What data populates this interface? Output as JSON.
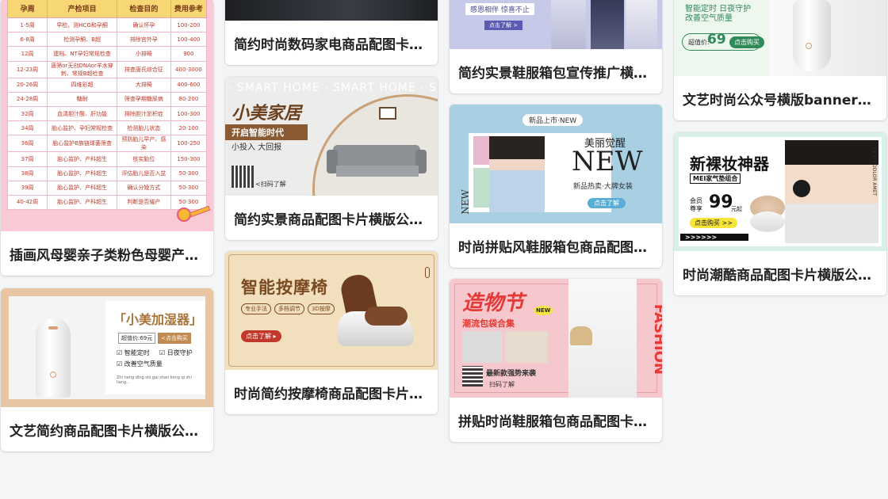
{
  "cards": [
    {
      "title": "插画风母婴亲子类粉色母婴产检时间表"
    },
    {
      "title": "文艺简约商品配图卡片横版公众号首图"
    },
    {
      "title": "简约时尚数码家电商品配图卡片横版"
    },
    {
      "title": "简约实景商品配图卡片横版公众号首图"
    },
    {
      "title": "时尚简约按摩椅商品配图卡片横版公众号"
    },
    {
      "title": "简约实景鞋服箱包宣传推广横版配图"
    },
    {
      "title": "时尚拼贴风鞋服箱包商品配图卡片横版"
    },
    {
      "title": "拼贴时尚鞋服箱包商品配图卡片横版"
    },
    {
      "title": "文艺时尚公众号横版banner配图"
    },
    {
      "title": "时尚潮酷商品配图卡片横版公众号首图"
    }
  ],
  "schedule": {
    "headers": [
      "孕周",
      "产检项目",
      "检查目的",
      "费用参考"
    ],
    "rows": [
      [
        "1-5周",
        "早检、测HCG和孕酮",
        "确认怀孕",
        "100-200"
      ],
      [
        "6-8周",
        "检测孕酮、B超",
        "排除宫外孕",
        "100-400"
      ],
      [
        "12周",
        "建档、NT孕妇常规检查",
        "小排畸",
        "900"
      ],
      [
        "12-23周",
        "唐筛or无创DNAor羊水穿刺、常规B超检查",
        "排查唐氏综合征",
        "400-3000"
      ],
      [
        "20-26周",
        "四维彩超",
        "大排畸",
        "400-600"
      ],
      [
        "24-28周",
        "糖耐",
        "筛查孕期糖尿病",
        "80-200"
      ],
      [
        "32周",
        "血清胆汁酸、肝功能",
        "排除胆汁淤积症",
        "100-300"
      ],
      [
        "34周",
        "胎心监护、孕妇常规检查",
        "检测胎儿状态",
        "20-100"
      ],
      [
        "36周",
        "胎心监护B族链球菌筛查",
        "预防胎儿早产、感染",
        "100-250"
      ],
      [
        "37周",
        "胎心监护、产科超生",
        "核实胎位",
        "150-300"
      ],
      [
        "38周",
        "胎心监护、产科超生",
        "评估胎儿是否入盆",
        "50-300"
      ],
      [
        "39周",
        "胎心监护、产科超生",
        "确认分娩方式",
        "50-300"
      ],
      [
        "40-42周",
        "胎心监护、产科超生",
        "判断是否催产",
        "50-300"
      ]
    ]
  },
  "humidifier": {
    "title": "「小美加湿器」",
    "price_label": "超值价:69元",
    "buy_label": "<点击购买",
    "features": [
      "☑ 智能定时",
      "☑ 日夜守护",
      "☑ 改善空气质量"
    ],
    "pinyin": "Zhi neng ding shi gai shan kong qi zhi liang..."
  },
  "digital": {
    "caption": ""
  },
  "home": {
    "watermark": "· SMART HOME · SMART HOME · S",
    "brand": "小美家居",
    "slogan": "开启智能时代",
    "sub": "小投入 大回报",
    "scan": "<扫码了解"
  },
  "massage": {
    "title": "智能按摩椅",
    "tags": [
      "专业手法",
      "多档调节",
      "3D按摩"
    ],
    "cta": "点击了解 ▸"
  },
  "fashion1": {
    "tag": "感恩相伴 惊喜不止",
    "cta": "点击了解 >"
  },
  "newarrival": {
    "top": "新品上市·NEW",
    "h1": "美丽觉醒",
    "h2": "NEW",
    "h3": "新品热卖·大牌女装",
    "cta": "点击了解",
    "side": "NEW"
  },
  "festival": {
    "title": "造物节",
    "badge": "NEW",
    "sub": "潮流包袋合集",
    "line1": "最新款强势来袭",
    "line2": "扫码了解",
    "side": "FASHION"
  },
  "banner": {
    "line1": "智能定时 日夜守护",
    "line2": "改善空气质量",
    "price_prefix": "超值价:",
    "price": "69",
    "cta": "点击购买"
  },
  "makeup": {
    "title": "新裸妆神器",
    "sub": "MEI家气垫组合",
    "member": "会员\n尊享",
    "price": "99",
    "unit": "元起",
    "cta": "点击购买 >>",
    "arrows": ">>>>>>",
    "side": "CE SIT DOLOR AMET"
  },
  "colors": {
    "pink": "#f7a8bf",
    "accent": "#e84a5f",
    "brown": "#7a4a22",
    "green": "#2e8b57"
  }
}
